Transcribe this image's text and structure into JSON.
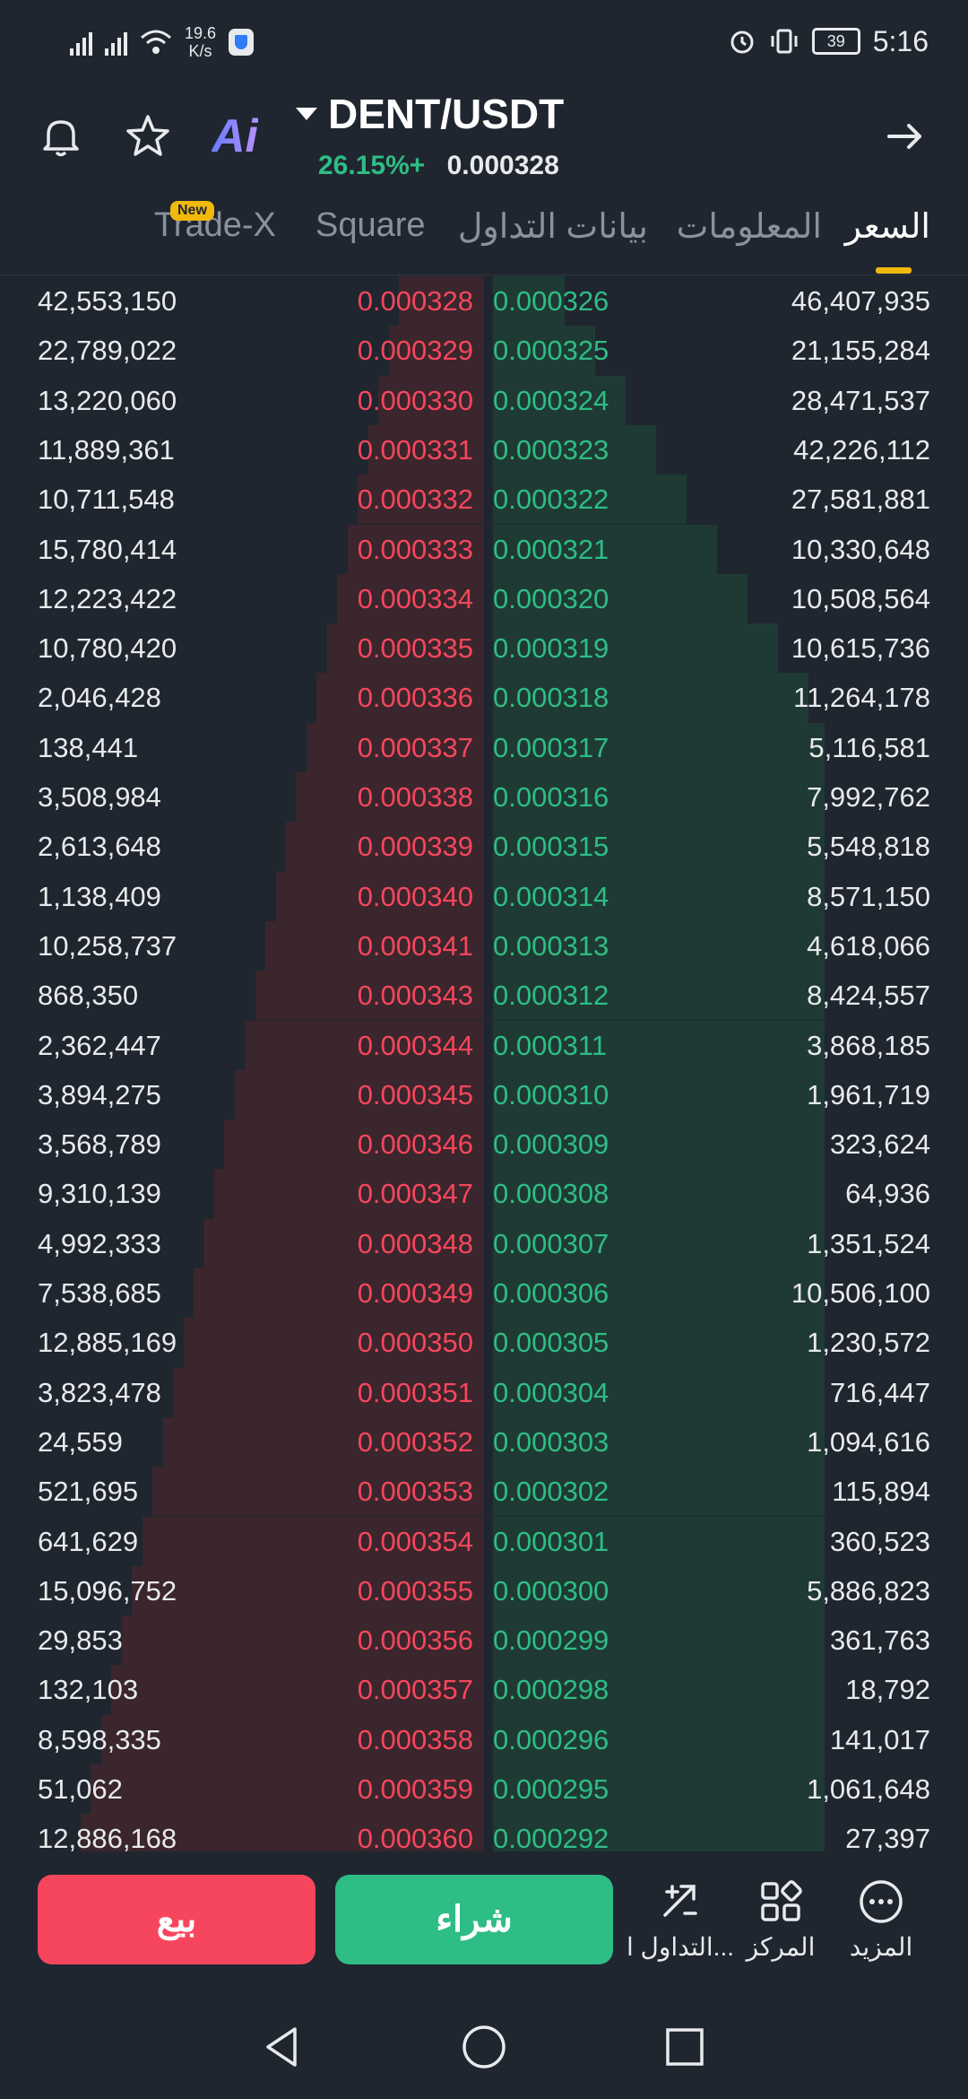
{
  "status_bar": {
    "net_speed_value": "19.6",
    "net_speed_unit": "K/s",
    "battery": "39",
    "time": "5:16"
  },
  "header": {
    "pair": "DENT/USDT",
    "change": "26.15%+",
    "price": "0.000328",
    "ai_label": "Ai"
  },
  "tabs": [
    {
      "label": "السعر"
    },
    {
      "label": "المعلومات"
    },
    {
      "label": "بيانات التداول"
    },
    {
      "label": "Square"
    },
    {
      "label": "Trade-X",
      "badge": "New"
    }
  ],
  "order_book": {
    "rows": [
      {
        "ask_qty": "42,553,150",
        "ask_price": "0.000328",
        "bid_price": "0.000326",
        "bid_qty": "46,407,935"
      },
      {
        "ask_qty": "22,789,022",
        "ask_price": "0.000329",
        "bid_price": "0.000325",
        "bid_qty": "21,155,284"
      },
      {
        "ask_qty": "13,220,060",
        "ask_price": "0.000330",
        "bid_price": "0.000324",
        "bid_qty": "28,471,537"
      },
      {
        "ask_qty": "11,889,361",
        "ask_price": "0.000331",
        "bid_price": "0.000323",
        "bid_qty": "42,226,112"
      },
      {
        "ask_qty": "10,711,548",
        "ask_price": "0.000332",
        "bid_price": "0.000322",
        "bid_qty": "27,581,881"
      },
      {
        "ask_qty": "15,780,414",
        "ask_price": "0.000333",
        "bid_price": "0.000321",
        "bid_qty": "10,330,648"
      },
      {
        "ask_qty": "12,223,422",
        "ask_price": "0.000334",
        "bid_price": "0.000320",
        "bid_qty": "10,508,564"
      },
      {
        "ask_qty": "10,780,420",
        "ask_price": "0.000335",
        "bid_price": "0.000319",
        "bid_qty": "10,615,736"
      },
      {
        "ask_qty": "2,046,428",
        "ask_price": "0.000336",
        "bid_price": "0.000318",
        "bid_qty": "11,264,178"
      },
      {
        "ask_qty": "138,441",
        "ask_price": "0.000337",
        "bid_price": "0.000317",
        "bid_qty": "5,116,581"
      },
      {
        "ask_qty": "3,508,984",
        "ask_price": "0.000338",
        "bid_price": "0.000316",
        "bid_qty": "7,992,762"
      },
      {
        "ask_qty": "2,613,648",
        "ask_price": "0.000339",
        "bid_price": "0.000315",
        "bid_qty": "5,548,818"
      },
      {
        "ask_qty": "1,138,409",
        "ask_price": "0.000340",
        "bid_price": "0.000314",
        "bid_qty": "8,571,150"
      },
      {
        "ask_qty": "10,258,737",
        "ask_price": "0.000341",
        "bid_price": "0.000313",
        "bid_qty": "4,618,066"
      },
      {
        "ask_qty": "868,350",
        "ask_price": "0.000343",
        "bid_price": "0.000312",
        "bid_qty": "8,424,557"
      },
      {
        "ask_qty": "2,362,447",
        "ask_price": "0.000344",
        "bid_price": "0.000311",
        "bid_qty": "3,868,185"
      },
      {
        "ask_qty": "3,894,275",
        "ask_price": "0.000345",
        "bid_price": "0.000310",
        "bid_qty": "1,961,719"
      },
      {
        "ask_qty": "3,568,789",
        "ask_price": "0.000346",
        "bid_price": "0.000309",
        "bid_qty": "323,624"
      },
      {
        "ask_qty": "9,310,139",
        "ask_price": "0.000347",
        "bid_price": "0.000308",
        "bid_qty": "64,936"
      },
      {
        "ask_qty": "4,992,333",
        "ask_price": "0.000348",
        "bid_price": "0.000307",
        "bid_qty": "1,351,524"
      },
      {
        "ask_qty": "7,538,685",
        "ask_price": "0.000349",
        "bid_price": "0.000306",
        "bid_qty": "10,506,100"
      },
      {
        "ask_qty": "12,885,169",
        "ask_price": "0.000350",
        "bid_price": "0.000305",
        "bid_qty": "1,230,572"
      },
      {
        "ask_qty": "3,823,478",
        "ask_price": "0.000351",
        "bid_price": "0.000304",
        "bid_qty": "716,447"
      },
      {
        "ask_qty": "24,559",
        "ask_price": "0.000352",
        "bid_price": "0.000303",
        "bid_qty": "1,094,616"
      },
      {
        "ask_qty": "521,695",
        "ask_price": "0.000353",
        "bid_price": "0.000302",
        "bid_qty": "115,894"
      },
      {
        "ask_qty": "641,629",
        "ask_price": "0.000354",
        "bid_price": "0.000301",
        "bid_qty": "360,523"
      },
      {
        "ask_qty": "15,096,752",
        "ask_price": "0.000355",
        "bid_price": "0.000300",
        "bid_qty": "5,886,823"
      },
      {
        "ask_qty": "29,853",
        "ask_price": "0.000356",
        "bid_price": "0.000299",
        "bid_qty": "361,763"
      },
      {
        "ask_qty": "132,103",
        "ask_price": "0.000357",
        "bid_price": "0.000298",
        "bid_qty": "18,792"
      },
      {
        "ask_qty": "8,598,335",
        "ask_price": "0.000358",
        "bid_price": "0.000296",
        "bid_qty": "141,017"
      },
      {
        "ask_qty": "51,062",
        "ask_price": "0.000359",
        "bid_price": "0.000295",
        "bid_qty": "1,061,648"
      },
      {
        "ask_qty": "12,886,168",
        "ask_price": "0.000360",
        "bid_price": "0.000292",
        "bid_qty": "27,397"
      }
    ]
  },
  "bottom_bar": {
    "sell": "بيع",
    "buy": "شراء",
    "trade": "التداول ا...",
    "center": "المركز",
    "more": "المزيد"
  },
  "colors": {
    "background": "#1f262f",
    "ask": "#f6465d",
    "bid": "#2ebd85",
    "accent": "#f0b90b"
  }
}
